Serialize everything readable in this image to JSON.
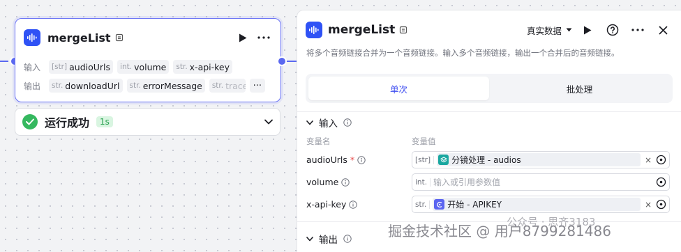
{
  "node": {
    "title": "mergeList",
    "input_label": "输入",
    "output_label": "输出",
    "inputs": [
      {
        "type": "[str]",
        "name": "audioUrls"
      },
      {
        "type": "int.",
        "name": "volume"
      },
      {
        "type": "str.",
        "name": "x-api-key"
      }
    ],
    "outputs": [
      {
        "type": "str.",
        "name": "downloadUrl"
      },
      {
        "type": "str.",
        "name": "errorMessage"
      },
      {
        "type": "str.",
        "name": "trace"
      }
    ],
    "more": "···"
  },
  "status": {
    "text": "运行成功",
    "duration": "1s",
    "success_color": "#35b85f"
  },
  "panel": {
    "title": "mergeList",
    "mode": "真实数据",
    "description": "将多个音频链接合并为一个音频链接。输入多个音频链接，输出一个合并后的音频链接。",
    "tabs": [
      "单次",
      "批处理"
    ],
    "input_section": "输入",
    "output_section": "输出",
    "col_name": "变量名",
    "col_value": "变量值",
    "params": [
      {
        "name": "audioUrls",
        "required": "*",
        "type": "[str]",
        "ref_text": "分镜处理 - audios",
        "ref_color": "#19a7a0",
        "clear": "×"
      },
      {
        "name": "volume",
        "type": "int.",
        "placeholder": "输入或引用参数值"
      },
      {
        "name": "x-api-key",
        "type": "str.",
        "ref_text": "开始 - APIKEY",
        "ref_color": "#5b64f0",
        "clear": "×"
      }
    ]
  },
  "colors": {
    "accent": "#5a68f0",
    "brand": "#2f52f5"
  },
  "watermark": {
    "text": "掘金技术社区 @ 用户8799281486",
    "logo_text": "公众号 · 思齐3183"
  }
}
